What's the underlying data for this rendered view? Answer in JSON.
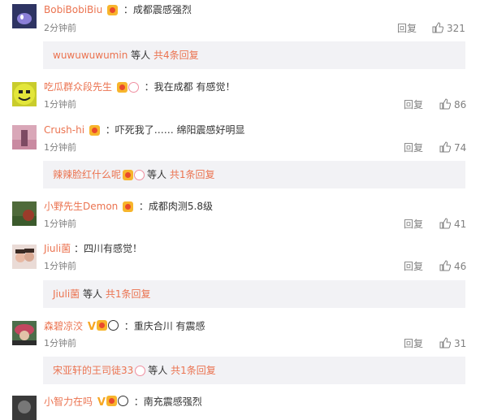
{
  "comments": [
    {
      "user": "BobiBobiBiu",
      "badges": [
        "gold"
      ],
      "text": "：成都震感强烈",
      "time": "2分钟前",
      "reply": "回复",
      "likes": "321"
    },
    {
      "user": "吃瓜群众段先生",
      "badges": [
        "gold",
        "face"
      ],
      "text": "：我在成都 有感觉！",
      "time": "1分钟前",
      "reply": "回复",
      "likes": "86"
    },
    {
      "user": "Crush-hi",
      "badges": [
        "gold"
      ],
      "text": "：吓死我了…… 绵阳震感好明显",
      "time": "1分钟前",
      "reply": "回复",
      "likes": "74"
    },
    {
      "user": "小野先生Demon",
      "badges": [
        "gold"
      ],
      "text": "：成都肉测5.8级",
      "time": "1分钟前",
      "reply": "回复",
      "likes": "41"
    },
    {
      "user": "Jiuli菌",
      "badges": [],
      "text": "：四川有感觉！",
      "time": "1分钟前",
      "reply": "回复",
      "likes": "46"
    },
    {
      "user": "森碧凉洨",
      "badges": [
        "v",
        "gold",
        "panda"
      ],
      "text": "：重庆合川 有震感",
      "time": "1分钟前",
      "reply": "回复",
      "likes": "31"
    },
    {
      "user": "小智力在吗",
      "badges": [
        "v",
        "gold",
        "panda"
      ],
      "text": "：南充震感强烈",
      "time": "",
      "reply": "",
      "likes": ""
    }
  ],
  "reply_boxes": [
    {
      "user": "wuwuwuwumin",
      "mid": "等人",
      "link": "共4条回复"
    },
    {
      "user": "辣辣脸红什么呢",
      "mid": "等人",
      "link": "共1条回复"
    },
    {
      "user": "Jiuli菌",
      "mid": "等人",
      "link": "共1条回复"
    },
    {
      "user": "宋亚轩的王司徒33",
      "mid": "等人",
      "link": "共1条回复"
    }
  ],
  "colors": {
    "username": "#eb7350",
    "reply_box_bg": "#f2f2f5",
    "meta": "#808080"
  }
}
